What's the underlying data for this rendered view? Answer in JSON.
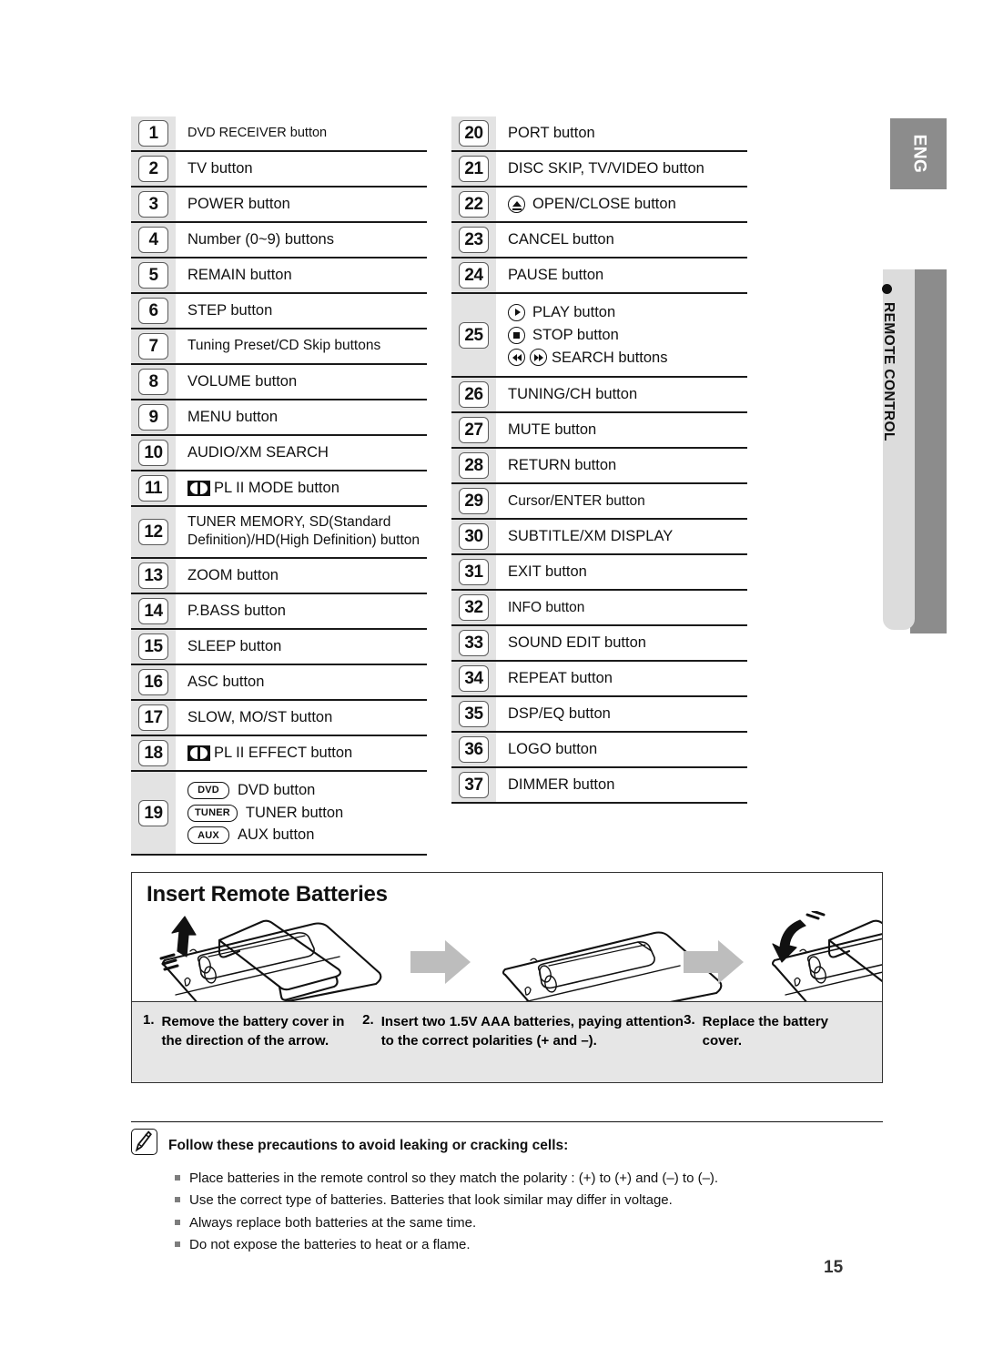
{
  "side_tabs": {
    "language": "ENG",
    "section": "REMOTE CONTROL"
  },
  "button_list": {
    "left_column": [
      {
        "num": "1",
        "text": "DVD RECEIVER button",
        "style": "small"
      },
      {
        "num": "2",
        "text": "TV button"
      },
      {
        "num": "3",
        "text": "POWER button"
      },
      {
        "num": "4",
        "text": "Number (0~9) buttons"
      },
      {
        "num": "5",
        "text": "REMAIN button"
      },
      {
        "num": "6",
        "text": "STEP button"
      },
      {
        "num": "7",
        "text": "Tuning Preset/CD Skip buttons",
        "style": "cond"
      },
      {
        "num": "8",
        "text": "VOLUME button"
      },
      {
        "num": "9",
        "text": "MENU button"
      },
      {
        "num": "10",
        "text": "AUDIO/XM SEARCH"
      },
      {
        "num": "11",
        "text": "PL II MODE button",
        "icon": "dolby-prologic-icon"
      },
      {
        "num": "12",
        "text": "TUNER MEMORY, SD(Standard Definition)/HD(High Definition) button",
        "style": "cond"
      },
      {
        "num": "13",
        "text": "ZOOM button"
      },
      {
        "num": "14",
        "text": "P.BASS button"
      },
      {
        "num": "15",
        "text": "SLEEP button"
      },
      {
        "num": "16",
        "text": "ASC button"
      },
      {
        "num": "17",
        "text": "SLOW, MO/ST button"
      },
      {
        "num": "18",
        "text": "PL II EFFECT button",
        "icon": "dolby-prologic-icon"
      },
      {
        "num": "19",
        "sub": [
          {
            "pill": "DVD",
            "text": "DVD button"
          },
          {
            "pill": "TUNER",
            "text": "TUNER button"
          },
          {
            "pill": "AUX",
            "text": "AUX button"
          }
        ]
      }
    ],
    "right_column": [
      {
        "num": "20",
        "text": "PORT button"
      },
      {
        "num": "21",
        "text": "DISC SKIP, TV/VIDEO button"
      },
      {
        "num": "22",
        "text": "OPEN/CLOSE button",
        "icon": "eject-icon"
      },
      {
        "num": "23",
        "text": "CANCEL button"
      },
      {
        "num": "24",
        "text": "PAUSE button"
      },
      {
        "num": "25",
        "sub": [
          {
            "icon": "play-icon",
            "text": "PLAY button"
          },
          {
            "icon": "stop-icon",
            "text": "STOP button"
          },
          {
            "icon": "search-icons",
            "text": "SEARCH buttons"
          }
        ]
      },
      {
        "num": "26",
        "text": "TUNING/CH button"
      },
      {
        "num": "27",
        "text": "MUTE button"
      },
      {
        "num": "28",
        "text": "RETURN button"
      },
      {
        "num": "29",
        "text": "Cursor/ENTER button",
        "style": "cond"
      },
      {
        "num": "30",
        "text": "SUBTITLE/XM DISPLAY"
      },
      {
        "num": "31",
        "text": "EXIT button"
      },
      {
        "num": "32",
        "text": "INFO button",
        "style": "cond"
      },
      {
        "num": "33",
        "text": "SOUND EDIT button"
      },
      {
        "num": "34",
        "text": "REPEAT button"
      },
      {
        "num": "35",
        "text": "DSP/EQ button"
      },
      {
        "num": "36",
        "text": "LOGO button"
      },
      {
        "num": "37",
        "text": "DIMMER button"
      }
    ]
  },
  "battery_panel": {
    "title": "Insert Remote Batteries",
    "steps": [
      {
        "num": "1.",
        "text": "Remove the battery cover in the direction of the arrow."
      },
      {
        "num": "2.",
        "text": "Insert two 1.5V AAA batteries, paying attention to the correct polarities (+ and –)."
      },
      {
        "num": "3.",
        "text": "Replace the battery cover."
      }
    ]
  },
  "note": {
    "title": "Follow these precautions to avoid leaking or cracking cells:",
    "items": [
      "Place batteries in the remote control so they match the polarity : (+) to (+) and (–) to (–).",
      "Use the correct type of batteries. Batteries that look similar may differ in voltage.",
      "Always replace both batteries at the same time.",
      "Do not expose the batteries to heat or a flame."
    ]
  },
  "page_number": "15",
  "colors": {
    "tab_dark": "#8c8c8c",
    "tab_light": "#dcdcdc",
    "row_num_bg": "#e3e3e3",
    "steps_bg": "#e6e6e6",
    "arrow_gray": "#bdbdbd"
  }
}
